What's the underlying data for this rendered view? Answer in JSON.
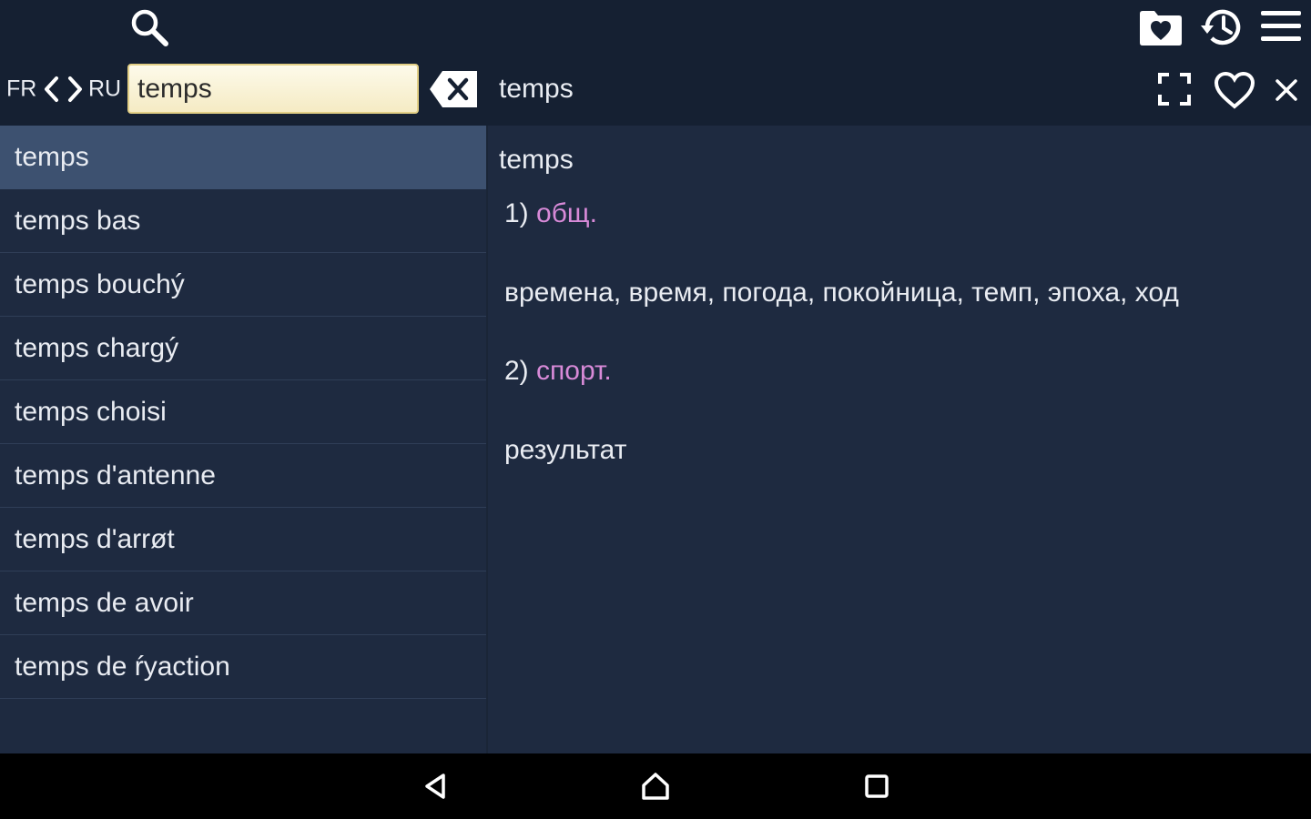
{
  "header": {
    "source_lang": "FR",
    "target_lang": "RU",
    "search_value": "temps",
    "entry_word": "temps",
    "icons": [
      "search-icon",
      "favorites-folder-icon",
      "history-icon",
      "menu-icon",
      "swap-left-icon",
      "swap-right-icon",
      "clear-input-icon",
      "fullscreen-icon",
      "heart-icon",
      "close-icon"
    ]
  },
  "results": [
    {
      "label": "temps",
      "selected": true
    },
    {
      "label": "temps bas"
    },
    {
      "label": "temps bouchý"
    },
    {
      "label": "temps chargý"
    },
    {
      "label": "temps choisi"
    },
    {
      "label": "temps d'antenne"
    },
    {
      "label": "temps d'arrøt"
    },
    {
      "label": "temps de avoir"
    },
    {
      "label": "temps de ŕyaction"
    }
  ],
  "detail": {
    "word": "temps",
    "senses": [
      {
        "number": "1)",
        "label": "общ.",
        "translation": "времена, время, погода, покойница, темп, эпоха, ход"
      },
      {
        "number": "2)",
        "label": "спорт.",
        "translation": "результат"
      }
    ]
  },
  "navbar": {
    "icons": [
      "back-icon",
      "home-icon",
      "recents-icon"
    ]
  },
  "colors": {
    "topbar": "#152032",
    "background": "#1e2a40",
    "selected_row": "#3d5170",
    "sense_label": "#d88ad8",
    "search_field": "#fbf3d6"
  }
}
